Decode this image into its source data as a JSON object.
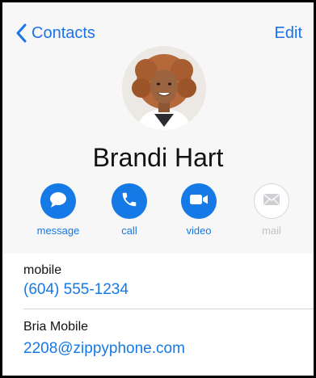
{
  "nav": {
    "back_label": "Contacts",
    "edit_label": "Edit"
  },
  "contact": {
    "name": "Brandi Hart"
  },
  "actions": [
    {
      "label": "message",
      "icon": "message-bubble-icon",
      "enabled": true
    },
    {
      "label": "call",
      "icon": "phone-icon",
      "enabled": true
    },
    {
      "label": "video",
      "icon": "video-camera-icon",
      "enabled": true
    },
    {
      "label": "mail",
      "icon": "envelope-icon",
      "enabled": false
    }
  ],
  "fields": [
    {
      "title": "mobile",
      "value": "(604) 555-1234"
    },
    {
      "title": "Bria Mobile",
      "value": "2208@zippyphone.com"
    }
  ],
  "colors": {
    "accent": "#1579e6",
    "header_bg": "#f7f7f8",
    "disabled": "#c2c2c6"
  }
}
